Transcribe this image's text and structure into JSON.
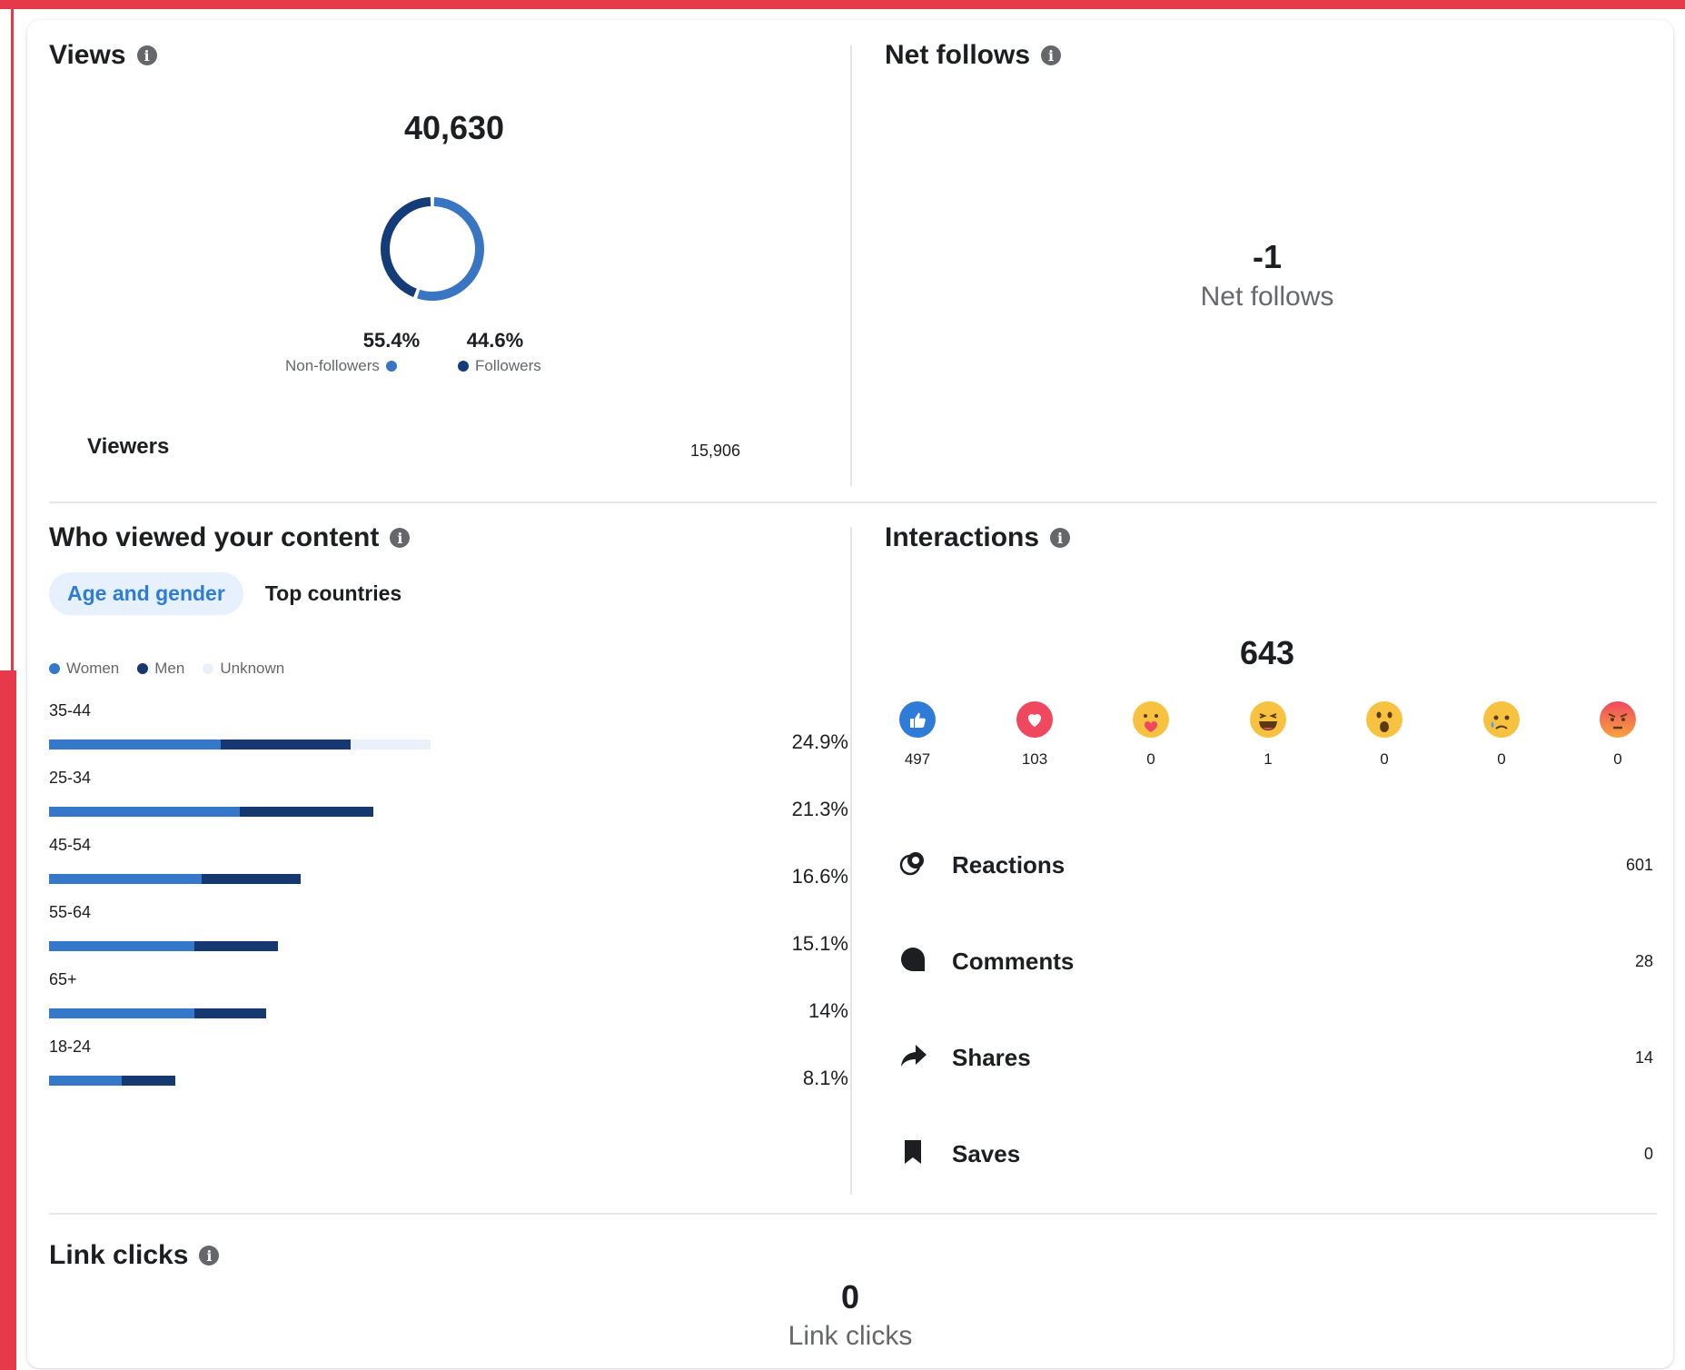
{
  "views": {
    "title": "Views",
    "total": "40,630",
    "non_followers_pct": "55.4%",
    "non_followers_label": "Non-followers",
    "followers_pct": "44.6%",
    "followers_label": "Followers",
    "viewers_label": "Viewers",
    "viewers_value": "15,906",
    "donut": {
      "non_followers": 55.4,
      "followers": 44.6,
      "non_followers_color": "#3a75c4",
      "followers_color": "#143c78"
    }
  },
  "net_follows": {
    "title": "Net follows",
    "value": "-1",
    "label": "Net follows"
  },
  "who_viewed": {
    "title": "Who viewed your content",
    "tabs": [
      "Age and gender",
      "Top countries"
    ],
    "legend": [
      "Women",
      "Men",
      "Unknown"
    ],
    "rows": [
      {
        "age": "35-44",
        "pct": "24.9%",
        "women": 0.45,
        "men": 0.34,
        "unknown": 0.21
      },
      {
        "age": "25-34",
        "pct": "21.3%",
        "women": 0.5,
        "men": 0.35,
        "unknown": 0.0
      },
      {
        "age": "45-54",
        "pct": "16.6%",
        "women": 0.4,
        "men": 0.26,
        "unknown": 0.0
      },
      {
        "age": "55-64",
        "pct": "15.1%",
        "women": 0.38,
        "men": 0.22,
        "unknown": 0.0
      },
      {
        "age": "65+",
        "pct": "14%",
        "women": 0.38,
        "men": 0.19,
        "unknown": 0.0
      },
      {
        "age": "18-24",
        "pct": "8.1%",
        "women": 0.19,
        "men": 0.14,
        "unknown": 0.0
      }
    ]
  },
  "interactions": {
    "title": "Interactions",
    "total": "643",
    "reactions": [
      {
        "icon": "like-icon",
        "count": "497"
      },
      {
        "icon": "love-icon",
        "count": "103"
      },
      {
        "icon": "care-icon",
        "count": "0"
      },
      {
        "icon": "haha-icon",
        "count": "1"
      },
      {
        "icon": "wow-icon",
        "count": "0"
      },
      {
        "icon": "sad-icon",
        "count": "0"
      },
      {
        "icon": "angry-icon",
        "count": "0"
      }
    ],
    "rows": [
      {
        "icon": "reactions-icon",
        "label": "Reactions",
        "value": "601"
      },
      {
        "icon": "comments-icon",
        "label": "Comments",
        "value": "28"
      },
      {
        "icon": "shares-icon",
        "label": "Shares",
        "value": "14"
      },
      {
        "icon": "saves-icon",
        "label": "Saves",
        "value": "0"
      }
    ]
  },
  "link_clicks": {
    "title": "Link clicks",
    "value": "0",
    "label": "Link clicks"
  },
  "colors": {
    "women": "#3578c9",
    "men": "#14386f",
    "unknown": "#eaf1fb",
    "accent": "#2d7cd6",
    "frame": "#e63a4b"
  }
}
